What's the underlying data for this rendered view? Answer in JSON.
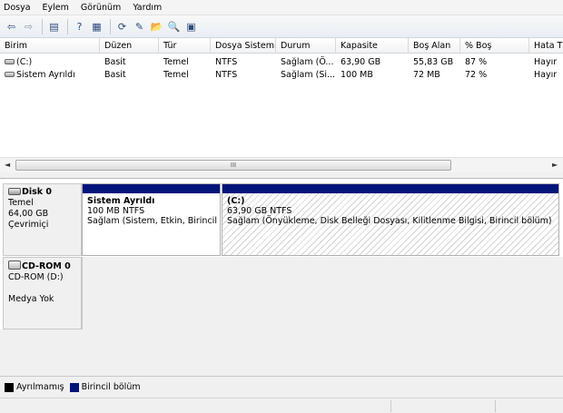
{
  "menu": [
    "Dosya",
    "Eylem",
    "Görünüm",
    "Yardım"
  ],
  "toolbar": [
    {
      "icon": "back-arrow-icon",
      "glyph": "⇦"
    },
    {
      "icon": "forward-arrow-icon",
      "glyph": "⇨"
    },
    {
      "icon": "properties-icon",
      "glyph": "▤"
    },
    {
      "icon": "help-icon",
      "glyph": "?"
    },
    {
      "icon": "console-icon",
      "glyph": "▦"
    },
    {
      "icon": "refresh-icon",
      "glyph": "⟳"
    },
    {
      "icon": "rescan-icon",
      "glyph": "✎"
    },
    {
      "icon": "open-folder-icon",
      "glyph": "📂"
    },
    {
      "icon": "search-icon",
      "glyph": "🔍"
    },
    {
      "icon": "properties-sheet-icon",
      "glyph": "▣"
    }
  ],
  "columns": [
    "Birim",
    "Düzen",
    "Tür",
    "Dosya Sistemi",
    "Durum",
    "Kapasite",
    "Boş Alan",
    "% Boş",
    "Hata T"
  ],
  "rows": [
    [
      "(C:)",
      "Basit",
      "Temel",
      "NTFS",
      "Sağlam (Ö...",
      "63,90 GB",
      "55,83 GB",
      "87 %",
      "Hayır"
    ],
    [
      "Sistem Ayrıldı",
      "Basit",
      "Temel",
      "NTFS",
      "Sağlam (Si...",
      "100 MB",
      "72 MB",
      "72 %",
      "Hayır"
    ]
  ],
  "scrollbar": {
    "grip": "III",
    "left_arrow": "◄",
    "right_arrow": "►"
  },
  "disk0": {
    "title": "Disk 0",
    "type": "Temel",
    "size": "64,00 GB",
    "status": "Çevrimiçi",
    "partitions": [
      {
        "name": "Sistem Ayrıldı",
        "size": "100 MB NTFS",
        "status": "Sağlam (Sistem, Etkin, Birincil bö"
      },
      {
        "name": "(C:)",
        "size": "63,90 GB NTFS",
        "status": "Sağlam (Önyükleme, Disk Belleği Dosyası, Kilitlenme Bilgisi, Birincil bölüm)"
      }
    ]
  },
  "cdrom0": {
    "title": "CD-ROM 0",
    "drive": "CD-ROM (D:)",
    "status": "Medya Yok"
  },
  "legend": [
    {
      "label": "Ayrılmamış",
      "color": "#000000"
    },
    {
      "label": "Birincil bölüm",
      "color": "#03157a"
    }
  ]
}
